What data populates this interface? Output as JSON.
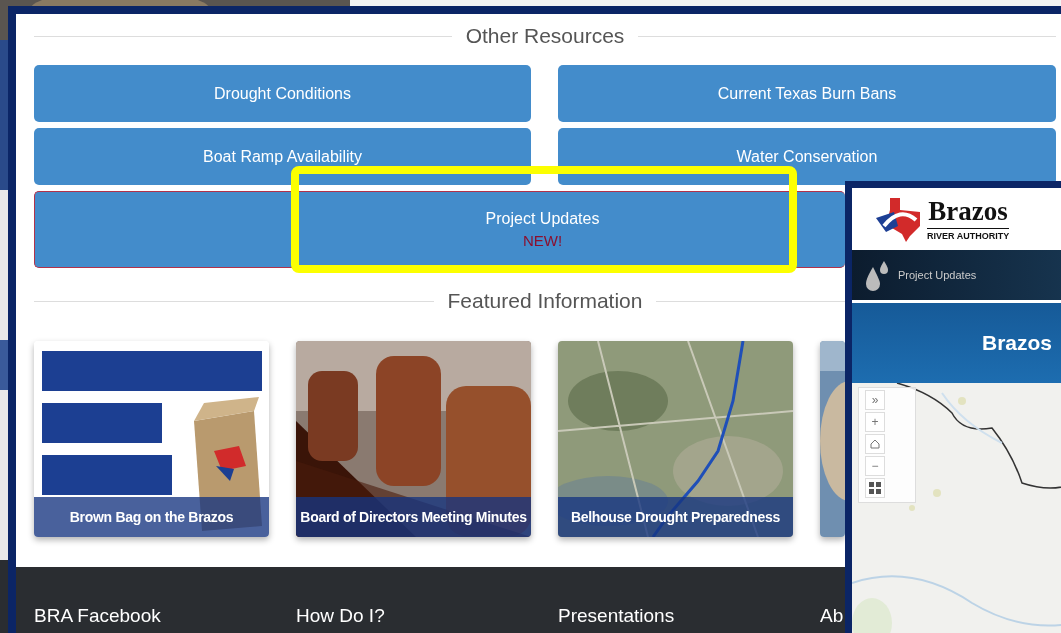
{
  "other_resources": {
    "heading": "Other Resources",
    "buttons": [
      {
        "label": "Drought Conditions"
      },
      {
        "label": "Current Texas Burn Bans"
      },
      {
        "label": "Boat Ramp Availability"
      },
      {
        "label": "Water Conservation"
      }
    ],
    "featured_button": {
      "label": "Project Updates",
      "badge": "NEW!"
    }
  },
  "featured_information": {
    "heading": "Featured Information",
    "cards": [
      {
        "kind": "bag",
        "caption": "Brown Bag on the Brazos"
      },
      {
        "kind": "chairs",
        "caption": "Board of Directors Meeting Minutes"
      },
      {
        "kind": "map",
        "caption": "Belhouse Drought Preparedness"
      },
      {
        "kind": "water"
      }
    ]
  },
  "footer": {
    "columns": [
      "BRA Facebook",
      "How Do I?",
      "Presentations",
      "Ab"
    ]
  },
  "preview": {
    "logo_name": "Brazos",
    "logo_subtitle": "RIVER AUTHORITY",
    "nav_label": "Project Updates",
    "banner_title": "Brazos",
    "map_controls": [
      {
        "kind": "expand",
        "symbol": "»"
      },
      {
        "kind": "zoom",
        "symbol": "+"
      },
      {
        "kind": "home"
      },
      {
        "kind": "zoom",
        "symbol": "−"
      },
      {
        "kind": "grid"
      }
    ]
  }
}
